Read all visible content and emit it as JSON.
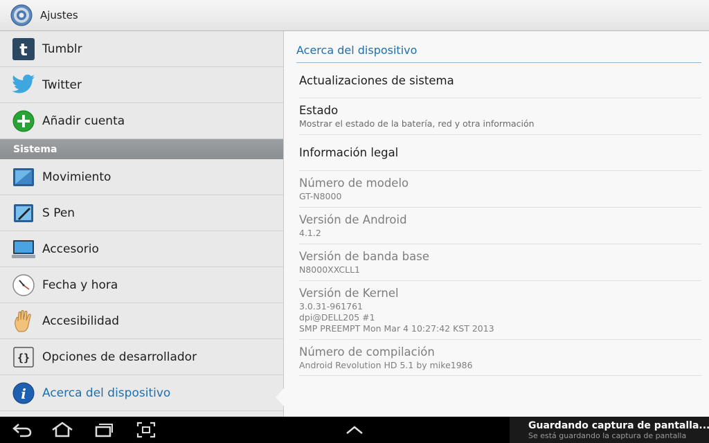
{
  "actionbar": {
    "title": "Ajustes",
    "icon": "settings-gear-icon"
  },
  "left": {
    "items_top": [
      {
        "label": "Tumblr",
        "icon": "tumblr-icon"
      },
      {
        "label": "Twitter",
        "icon": "twitter-icon"
      },
      {
        "label": "Añadir cuenta",
        "icon": "add-account-icon"
      }
    ],
    "section": "Sistema",
    "items": [
      {
        "label": "Movimiento",
        "icon": "motion-icon"
      },
      {
        "label": "S Pen",
        "icon": "s-pen-icon"
      },
      {
        "label": "Accesorio",
        "icon": "accessory-icon"
      },
      {
        "label": "Fecha y hora",
        "icon": "clock-icon"
      },
      {
        "label": "Accesibilidad",
        "icon": "hand-icon"
      },
      {
        "label": "Opciones de desarrollador",
        "icon": "braces-icon"
      },
      {
        "label": "Acerca del dispositivo",
        "icon": "info-icon",
        "selected": true
      }
    ]
  },
  "right": {
    "header": "Acerca del dispositivo",
    "items": [
      {
        "title": "Actualizaciones de sistema"
      },
      {
        "title": "Estado",
        "sub": "Mostrar el estado de la batería, red y otra información"
      },
      {
        "title": "Información legal"
      },
      {
        "title": "Número de modelo",
        "sub": "GT-N8000"
      },
      {
        "title": "Versión de Android",
        "sub": "4.1.2"
      },
      {
        "title": "Versión de banda base",
        "sub": "N8000XXCLL1"
      },
      {
        "title": "Versión de Kernel",
        "sub1": "3.0.31-961761",
        "sub2": "dpi@DELL205 #1",
        "sub3": "SMP PREEMPT Mon Mar 4 10:27:42 KST 2013"
      },
      {
        "title": "Número de compilación",
        "sub": "Android Revolution HD 5.1 by mike1986"
      }
    ]
  },
  "sysbar": {
    "notification_title": "Guardando captura de pantalla...",
    "notification_sub": "Se está guardando la captura de pantalla",
    "buttons": [
      "back-icon",
      "home-icon",
      "recent-apps-icon",
      "screenshot-icon",
      "chevron-up-icon"
    ]
  }
}
